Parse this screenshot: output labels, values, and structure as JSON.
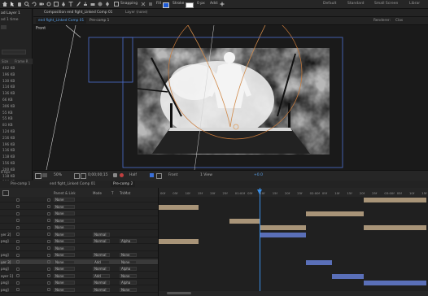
{
  "toolbar": {
    "snapping": "Snapping",
    "fill": "Fill",
    "stroke": "Stroke",
    "stroke_width": "0 px",
    "add": "Add:",
    "workspaces": [
      "Default",
      "Standard",
      "Small Screen",
      "Librar"
    ]
  },
  "project": {
    "title": "ad Layer 1",
    "subtitle": "ad 1 time",
    "col_size": "Size",
    "col_frame": "Frame R",
    "sizes": [
      "402 KB",
      "196 KB",
      "130 KB",
      "114 KB",
      "136 KB",
      "66 KB",
      "306 KB",
      "55 KB",
      "55 KB",
      "83 KB",
      "124 KB",
      "216 KB",
      "196 KB",
      "116 KB",
      "118 KB",
      "156 KB",
      "200 KB",
      "118 KB",
      "136 KB"
    ],
    "bit_depth": "8 bpc"
  },
  "comp": {
    "panel_tab": "Composition end fight_Linked Comp 01",
    "layer_label": "Layer (none)",
    "tabs": [
      "end fight_Linked Comp 01",
      "Pre-comp 1"
    ],
    "view_label": "Front",
    "renderer": "Renderer:",
    "renderer_value": "Clas",
    "footer": {
      "zoom": "50%",
      "timecode": "0;00;00;15",
      "resolution": "Half",
      "camera": "Front",
      "view": "1 View",
      "exposure": "+0.0"
    }
  },
  "timeline": {
    "tabs": [
      "Pre-comp 1",
      "end fight_Linked Comp 01",
      "Pre-comp 2"
    ],
    "col_parent": "Parent & Link",
    "col_mode": "Mode",
    "col_t": "T",
    "col_trkmat": "TrkMat",
    "ruler": [
      "00f",
      "05f",
      "10f",
      "15f",
      "20f",
      "25f",
      "01:00f",
      "05f",
      "10f",
      "15f",
      "20f",
      "25f",
      "02:00f",
      "05f",
      "10f",
      "15f",
      "20f",
      "25f",
      "03:00f",
      "05f",
      "10f",
      "15f"
    ],
    "layers": [
      {
        "name": "",
        "parent": "None",
        "mode": "",
        "trkmat": ""
      },
      {
        "name": "",
        "parent": "None",
        "mode": "",
        "trkmat": ""
      },
      {
        "name": "",
        "parent": "None",
        "mode": "",
        "trkmat": ""
      },
      {
        "name": "",
        "parent": "None",
        "mode": "",
        "trkmat": ""
      },
      {
        "name": "",
        "parent": "None",
        "mode": "",
        "trkmat": ""
      },
      {
        "name": "yer 2]",
        "parent": "None",
        "mode": "Normal",
        "trkmat": ""
      },
      {
        "name": "png]",
        "parent": "None",
        "mode": "Normal",
        "trkmat": "Alpha"
      },
      {
        "name": "",
        "parent": "None",
        "mode": "",
        "trkmat": ""
      },
      {
        "name": "png]",
        "parent": "None",
        "mode": "Normal",
        "trkmat": "None"
      },
      {
        "name": "yer 3]",
        "parent": "None",
        "mode": "Add",
        "trkmat": "None"
      },
      {
        "name": "png]",
        "parent": "None",
        "mode": "Normal",
        "trkmat": "Alpha"
      },
      {
        "name": "ayer 1]",
        "parent": "None",
        "mode": "Add",
        "trkmat": "None"
      },
      {
        "name": "png]",
        "parent": "None",
        "mode": "Normal",
        "trkmat": "Alpha"
      },
      {
        "name": "png]",
        "parent": "None",
        "mode": "Normal",
        "trkmat": "None"
      }
    ]
  }
}
